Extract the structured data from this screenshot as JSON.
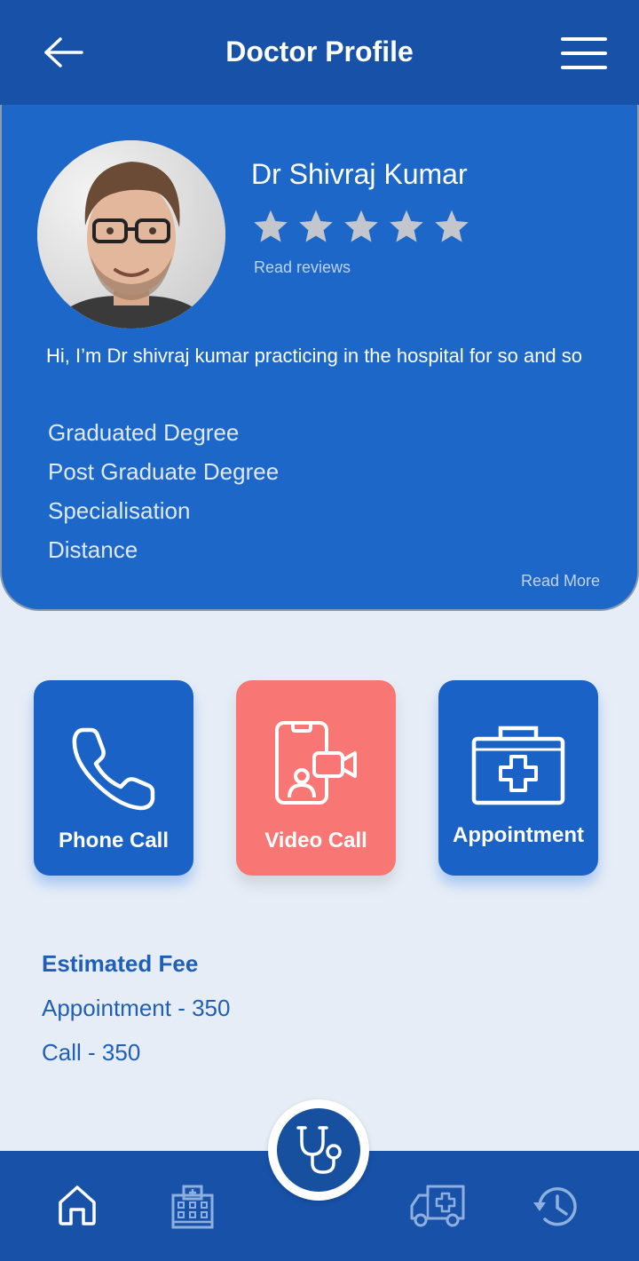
{
  "header": {
    "title": "Doctor Profile",
    "back_icon": "arrow-left-icon",
    "menu_icon": "hamburger-menu-icon"
  },
  "profile": {
    "name": "Dr Shivraj Kumar",
    "rating_stars": 5,
    "read_reviews_label": "Read reviews",
    "bio": "Hi, I’m Dr shivraj kumar practicing in the hospital for so and so",
    "credentials": [
      "Graduated Degree",
      "Post Graduate Degree",
      "Specialisation",
      "Distance"
    ],
    "read_more_label": "Read More"
  },
  "actions": [
    {
      "label": "Phone Call",
      "icon": "phone-icon",
      "color": "#1a62c5"
    },
    {
      "label": "Video Call",
      "icon": "video-call-icon",
      "color": "#f87775"
    },
    {
      "label": "Appointment",
      "icon": "medical-kit-icon",
      "color": "#1a62c5"
    }
  ],
  "fees": {
    "title": "Estimated Fee",
    "lines": [
      "Appointment - 350",
      "Call - 350"
    ]
  },
  "bottom_nav": {
    "items": [
      "home-icon",
      "hospital-icon",
      "stethoscope-icon",
      "ambulance-icon",
      "history-icon"
    ]
  },
  "colors": {
    "primary": "#1751a8",
    "card": "#1c67c7",
    "accent": "#f87775",
    "background": "#e6edf6"
  }
}
